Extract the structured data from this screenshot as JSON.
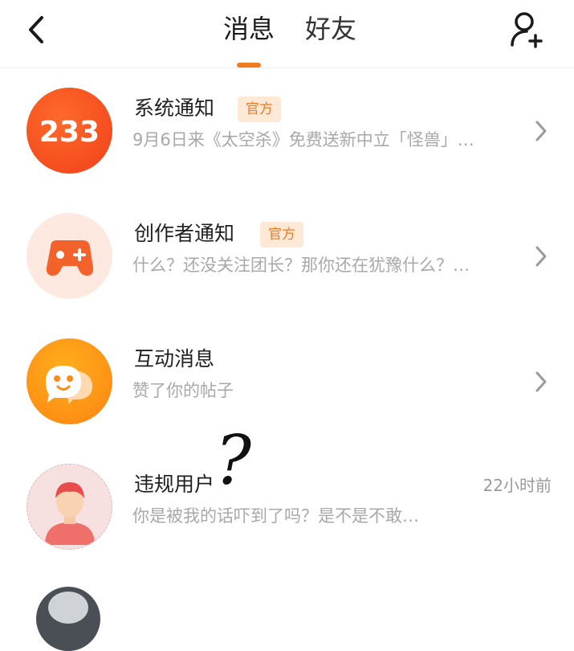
{
  "header": {
    "tabs": [
      {
        "label": "消息",
        "active": true
      },
      {
        "label": "好友",
        "active": false
      }
    ],
    "accent_color": "#f07a22"
  },
  "messages": [
    {
      "title": "系统通知",
      "badge": "官方",
      "preview": "9月6日来《太空杀》免费送新中立「怪兽」…",
      "avatar_text": "233",
      "avatar_icon": "233-logo"
    },
    {
      "title": "创作者通知",
      "badge": "官方",
      "preview": "什么？还没关注团长？那你还在犹豫什么？…",
      "avatar_icon": "gamepad-icon"
    },
    {
      "title": "互动消息",
      "preview": "赞了你的帖子",
      "avatar_icon": "chat-bubble-icon"
    },
    {
      "title": "违规用户",
      "preview": "你是被我的话吓到了吗？是不是不敢…",
      "time": "22小时前",
      "avatar_icon": "user-avatar",
      "overlay": "?"
    }
  ]
}
